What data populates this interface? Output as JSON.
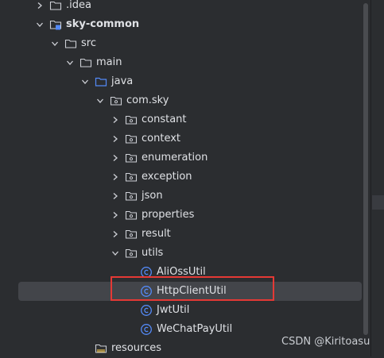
{
  "colors": {
    "background": "#2b2d30",
    "selection": "#43454a",
    "highlight_border": "#e53935",
    "folder_icon": "#ced0d6",
    "source_folder_icon": "#548af7",
    "class_icon": "#548af7",
    "text": "#dfe1e5"
  },
  "tree": {
    "items": [
      {
        "label": ".idea",
        "chevron": "collapsed",
        "icon": "folder-icon"
      },
      {
        "label": "sky-common",
        "chevron": "expanded",
        "icon": "module-folder-icon"
      },
      {
        "label": "src",
        "chevron": "expanded",
        "icon": "folder-icon"
      },
      {
        "label": "main",
        "chevron": "expanded",
        "icon": "folder-icon"
      },
      {
        "label": "java",
        "chevron": "expanded",
        "icon": "source-root-folder-icon"
      },
      {
        "label": "com.sky",
        "chevron": "expanded",
        "icon": "package-icon"
      },
      {
        "label": "constant",
        "chevron": "collapsed",
        "icon": "package-icon"
      },
      {
        "label": "context",
        "chevron": "collapsed",
        "icon": "package-icon"
      },
      {
        "label": "enumeration",
        "chevron": "collapsed",
        "icon": "package-icon"
      },
      {
        "label": "exception",
        "chevron": "collapsed",
        "icon": "package-icon"
      },
      {
        "label": "json",
        "chevron": "collapsed",
        "icon": "package-icon"
      },
      {
        "label": "properties",
        "chevron": "collapsed",
        "icon": "package-icon"
      },
      {
        "label": "result",
        "chevron": "collapsed",
        "icon": "package-icon"
      },
      {
        "label": "utils",
        "chevron": "expanded",
        "icon": "package-icon"
      },
      {
        "label": "AliOssUtil",
        "chevron": "none",
        "icon": "class-icon"
      },
      {
        "label": "HttpClientUtil",
        "chevron": "none",
        "icon": "class-icon",
        "selected": true
      },
      {
        "label": "JwtUtil",
        "chevron": "none",
        "icon": "class-icon"
      },
      {
        "label": "WeChatPayUtil",
        "chevron": "none",
        "icon": "class-icon"
      },
      {
        "label": "resources",
        "chevron": "none",
        "icon": "resources-folder-icon"
      }
    ]
  },
  "watermark": "CSDN @Kiritoasu"
}
